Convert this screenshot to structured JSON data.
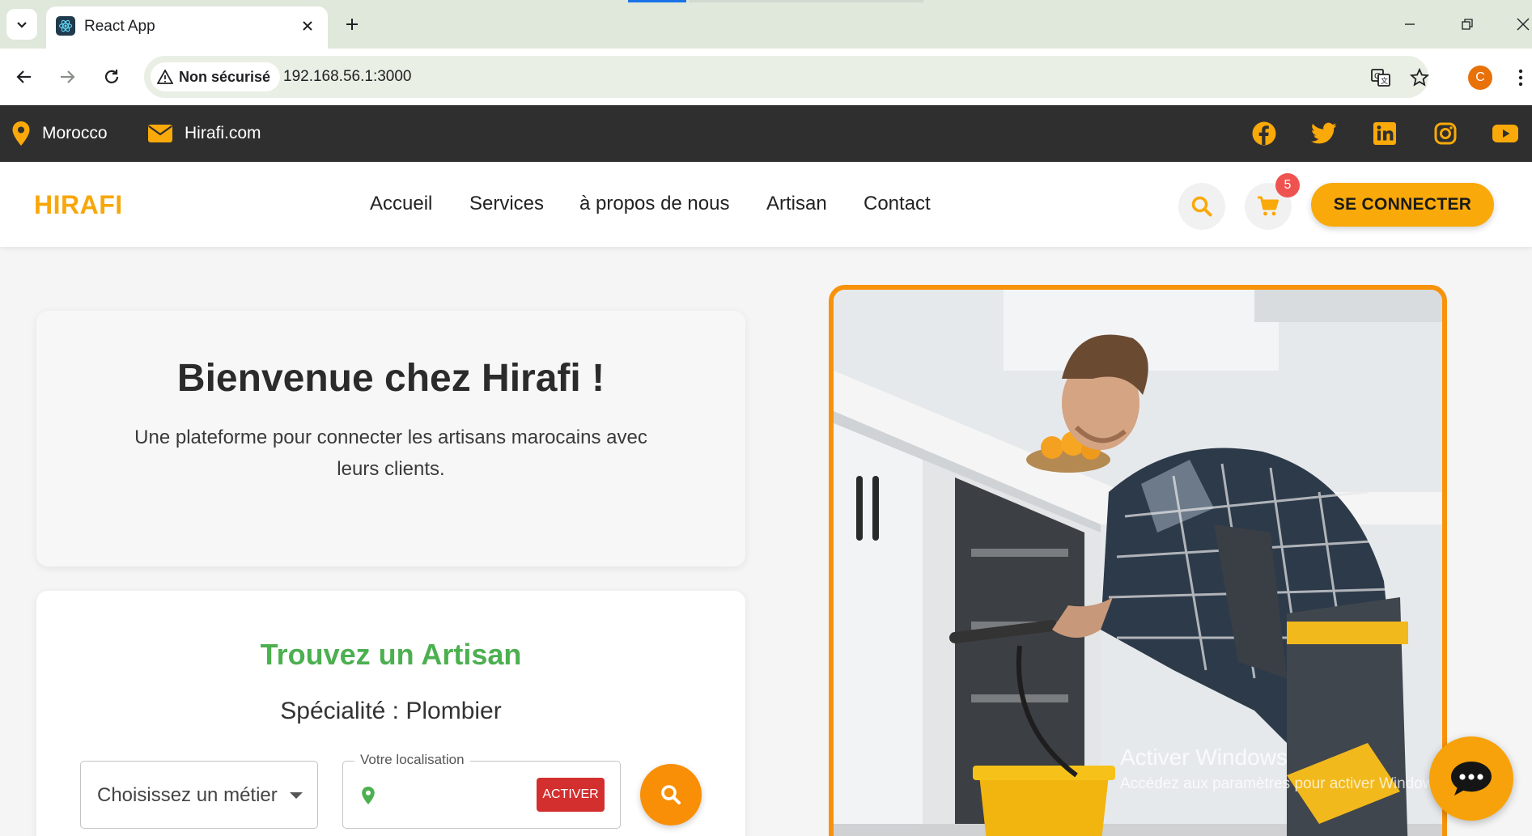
{
  "browser": {
    "tab_title": "React App",
    "security_label": "Non sécurisé",
    "url": "192.168.56.1:3000",
    "profile_initial": "C"
  },
  "infobar": {
    "location": "Morocco",
    "email": "Hirafi.com",
    "socials": [
      "facebook-icon",
      "twitter-icon",
      "linkedin-icon",
      "instagram-icon",
      "youtube-icon"
    ]
  },
  "header": {
    "logo": "HIRAFI",
    "nav": [
      "Accueil",
      "Services",
      "à propos de nous",
      "Artisan",
      "Contact"
    ],
    "cart_count": "5",
    "login_label": "SE CONNECTER"
  },
  "hero": {
    "title": "Bienvenue chez Hirafi !",
    "subtitle": "Une plateforme pour connecter les artisans marocains avec leurs clients."
  },
  "search": {
    "title": "Trouvez un Artisan",
    "specialty": "Spécialité : Plombier",
    "select_value": "Choisissez un métier",
    "location_label": "Votre localisation",
    "activate_label": "ACTIVER"
  },
  "watermark": {
    "title": "Activer Windows",
    "subtitle": "Accédez aux paramètres pour activer Windows."
  },
  "colors": {
    "accent": "#f9a909",
    "dark_bar": "#2f2f2f",
    "green": "#4caf50",
    "red": "#d32f2f"
  }
}
